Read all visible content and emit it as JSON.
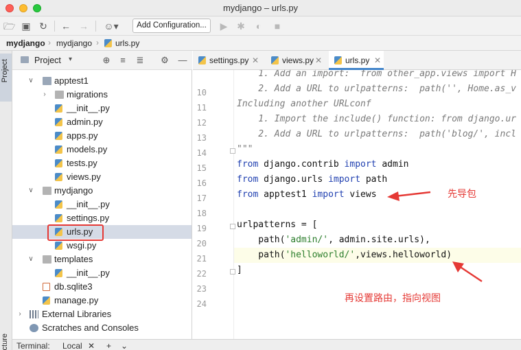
{
  "window": {
    "title": "mydjango – urls.py"
  },
  "toolbar": {
    "add_configuration": "Add Configuration..."
  },
  "breadcrumb": {
    "root": "mydjango",
    "folder": "mydjango",
    "file": "urls.py"
  },
  "side_stripe": {
    "project_tab": "Project",
    "structure_tab": "ucture"
  },
  "project_panel": {
    "title": "Project",
    "items": [
      {
        "label": "apptest1",
        "kind": "folder"
      },
      {
        "label": "migrations",
        "kind": "folder"
      },
      {
        "label": "__init__.py",
        "kind": "py"
      },
      {
        "label": "admin.py",
        "kind": "py"
      },
      {
        "label": "apps.py",
        "kind": "py"
      },
      {
        "label": "models.py",
        "kind": "py"
      },
      {
        "label": "tests.py",
        "kind": "py"
      },
      {
        "label": "views.py",
        "kind": "py"
      },
      {
        "label": "mydjango",
        "kind": "folder"
      },
      {
        "label": "__init__.py",
        "kind": "py"
      },
      {
        "label": "settings.py",
        "kind": "py"
      },
      {
        "label": "urls.py",
        "kind": "py"
      },
      {
        "label": "wsgi.py",
        "kind": "py"
      },
      {
        "label": "templates",
        "kind": "folder"
      },
      {
        "label": "__init__.py",
        "kind": "py"
      },
      {
        "label": "db.sqlite3",
        "kind": "db"
      },
      {
        "label": "manage.py",
        "kind": "py"
      },
      {
        "label": "External Libraries",
        "kind": "lib"
      },
      {
        "label": "Scratches and Consoles",
        "kind": "scratch"
      }
    ]
  },
  "editor": {
    "tabs": [
      {
        "label": "settings.py"
      },
      {
        "label": "views.py"
      },
      {
        "label": "urls.py"
      }
    ],
    "line_numbers": [
      "10",
      "11",
      "12",
      "13",
      "14",
      "15",
      "16",
      "17",
      "18",
      "19",
      "20",
      "21",
      "22",
      "23",
      "24"
    ],
    "lines": {
      "l10": "    1. Add an import:  from other_app.views import H",
      "l11": "    2. Add a URL to urlpatterns:  path('', Home.as_v",
      "l12": "Including another URLconf",
      "l13": "    1. Import the include() function: from django.ur",
      "l14": "    2. Add a URL to urlpatterns:  path('blog/', incl",
      "l15": "\"\"\"",
      "l16_kw1": "from",
      "l16_mod": " django.contrib ",
      "l16_kw2": "import",
      "l16_name": " admin",
      "l17_kw1": "from",
      "l17_mod": " django.urls ",
      "l17_kw2": "import",
      "l17_name": " path",
      "l18_kw1": "from",
      "l18_mod": " apptest1 ",
      "l18_kw2": "import",
      "l18_name": " views",
      "l20": "urlpatterns = [",
      "l21_a": "    path(",
      "l21_str": "'admin/'",
      "l21_b": ", admin.site.urls),",
      "l22_a": "    path(",
      "l22_str": "'helloworld/'",
      "l22_b": ",views.helloworld)",
      "l23": "]"
    }
  },
  "annotations": {
    "import_note": "先导包",
    "route_note": "再设置路由，指向视图"
  },
  "terminal": {
    "label": "Terminal:",
    "tab": "Local",
    "add": "+",
    "more": "⌄"
  }
}
